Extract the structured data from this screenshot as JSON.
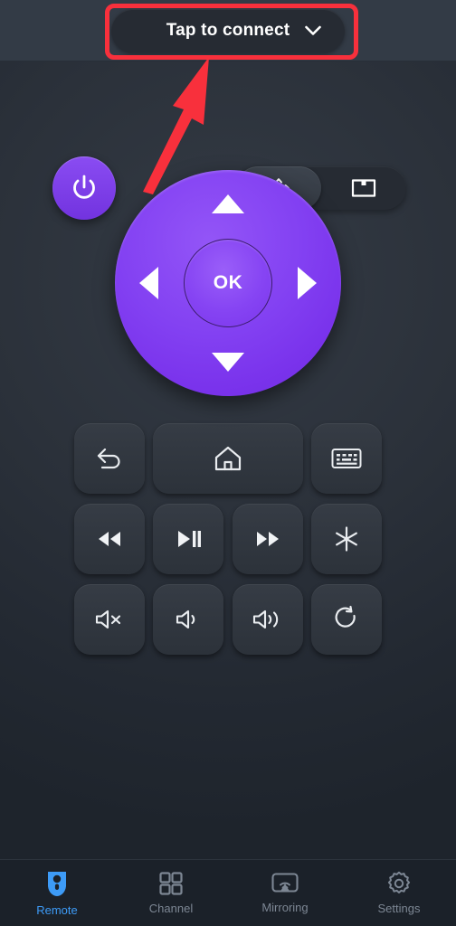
{
  "header": {
    "connect_label": "Tap to connect",
    "chevron_icon": "chevron-down-icon"
  },
  "annotation": {
    "box_color": "#f8303c",
    "arrow_color": "#f8303c",
    "target": "connect-button"
  },
  "top_controls": {
    "power_icon": "power-icon",
    "modes": [
      {
        "id": "dpad",
        "icon": "dpad-move-icon",
        "selected": true
      },
      {
        "id": "touchpad",
        "icon": "screen-touchpad-icon",
        "selected": false
      }
    ]
  },
  "dpad": {
    "ok_label": "OK",
    "up_icon": "arrow-up-icon",
    "down_icon": "arrow-down-icon",
    "left_icon": "arrow-left-icon",
    "right_icon": "arrow-right-icon",
    "accent_color": "#8341f2"
  },
  "keypad": {
    "rows": [
      [
        {
          "id": "back",
          "icon": "back-arrow-icon",
          "wide": false
        },
        {
          "id": "home",
          "icon": "home-icon",
          "wide": true
        },
        {
          "id": "keyboard",
          "icon": "keyboard-icon",
          "wide": false
        }
      ],
      [
        {
          "id": "rewind",
          "icon": "rewind-icon",
          "wide": false
        },
        {
          "id": "play-pause",
          "icon": "play-pause-icon",
          "wide": false
        },
        {
          "id": "fast-forward",
          "icon": "fast-forward-icon",
          "wide": false
        },
        {
          "id": "asterisk",
          "icon": "asterisk-icon",
          "wide": false
        }
      ],
      [
        {
          "id": "mute",
          "icon": "volume-mute-icon",
          "wide": false
        },
        {
          "id": "volume-down",
          "icon": "volume-down-icon",
          "wide": false
        },
        {
          "id": "volume-up",
          "icon": "volume-up-icon",
          "wide": false
        },
        {
          "id": "refresh",
          "icon": "refresh-icon",
          "wide": false
        }
      ]
    ]
  },
  "bottom_nav": {
    "active_color": "#3d9bf7",
    "inactive_color": "#7d8794",
    "items": [
      {
        "label": "Remote",
        "icon": "remote-icon",
        "active": true
      },
      {
        "label": "Channel",
        "icon": "grid-icon",
        "active": false
      },
      {
        "label": "Mirroring",
        "icon": "cast-icon",
        "active": false
      },
      {
        "label": "Settings",
        "icon": "gear-icon",
        "active": false
      }
    ]
  }
}
